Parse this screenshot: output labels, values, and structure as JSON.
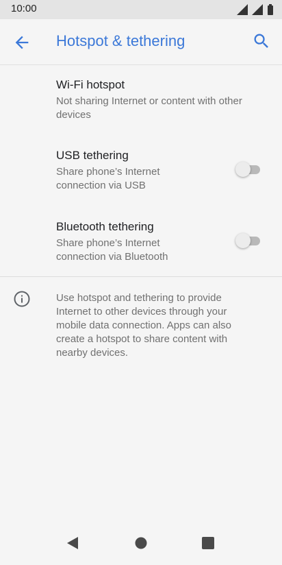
{
  "status_bar": {
    "time": "10:00"
  },
  "app_bar": {
    "title": "Hotspot & tethering"
  },
  "preferences": [
    {
      "title": "Wi-Fi hotspot",
      "summary_lines": [
        "Not sharing Internet or content with other",
        "devices"
      ]
    },
    {
      "title": "USB tethering",
      "summary_lines": [
        "Share phone’s Internet",
        "connection via USB"
      ],
      "switch_on": false
    },
    {
      "title": "Bluetooth tethering",
      "summary_lines": [
        "Share phone’s Internet",
        "connection via Bluetooth"
      ],
      "switch_on": false
    }
  ],
  "info": {
    "lines": [
      "Use hotspot and tethering to provide",
      "Internet to other devices through your",
      "mobile data connection. Apps can also",
      "create a hotspot to share content with",
      "nearby devices."
    ]
  },
  "icons": {
    "back": "arrow-back-icon",
    "search": "search-icon",
    "info": "info-icon",
    "nav_back": "nav-back-icon",
    "nav_home": "nav-home-icon",
    "nav_recents": "nav-recents-icon"
  },
  "colors": {
    "accent": "#3b78d8",
    "background": "#f5f5f5",
    "status_bar": "#e4e4e4",
    "summary_text": "#707070"
  }
}
